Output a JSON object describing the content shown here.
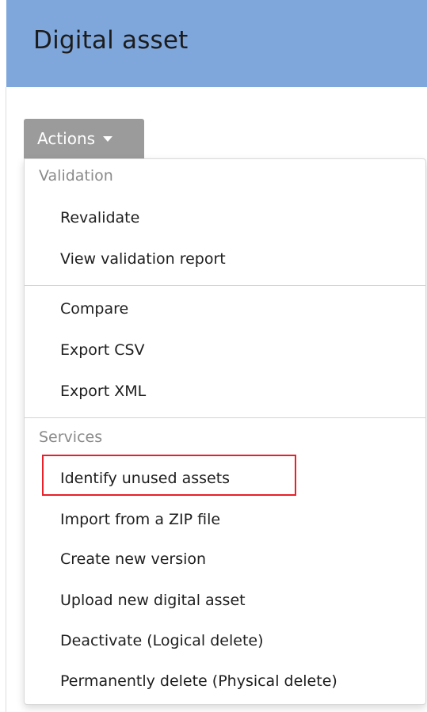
{
  "header": {
    "title": "Digital asset",
    "background_color": "#7fa7dc"
  },
  "actions": {
    "label": "Actions",
    "icon": "caret-down-icon",
    "color": "#9b9b9b"
  },
  "menu": {
    "validation": {
      "header": "Validation",
      "items": [
        "Revalidate",
        "View validation report"
      ]
    },
    "export": {
      "items": [
        "Compare",
        "Export CSV",
        "Export XML"
      ]
    },
    "services": {
      "header": "Services",
      "items": [
        "Identify unused assets",
        "Import from a ZIP file",
        "Create new version",
        "Upload new digital asset",
        "Deactivate (Logical delete)",
        "Permanently delete (Physical delete)"
      ]
    }
  },
  "highlight": {
    "target": "Identify unused assets",
    "color": "#e8202a"
  }
}
